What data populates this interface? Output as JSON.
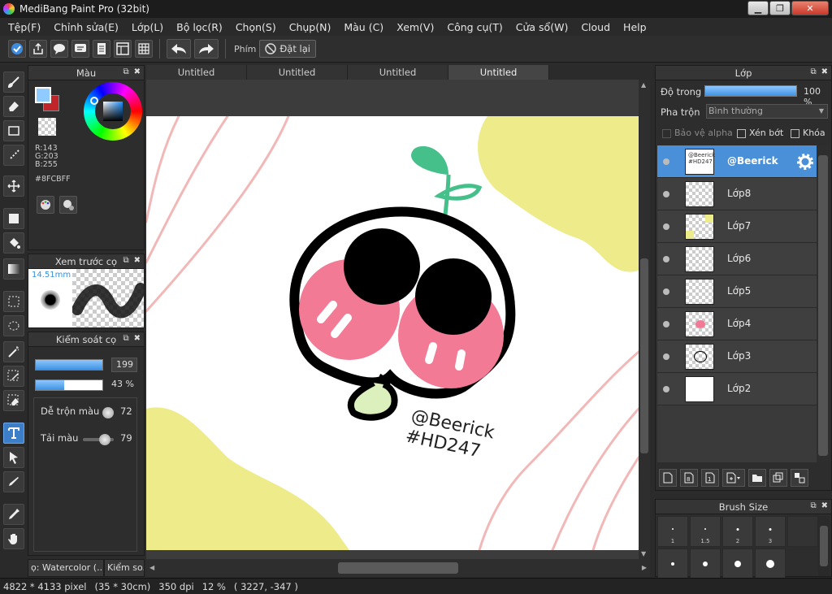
{
  "window": {
    "title": "MediBang Paint Pro (32bit)"
  },
  "menu": [
    "Tệp(F)",
    "Chỉnh sửa(E)",
    "Lớp(L)",
    "Bộ lọc(R)",
    "Chọn(S)",
    "Chụp(N)",
    "Màu (C)",
    "Xem(V)",
    "Công cụ(T)",
    "Cửa sổ(W)",
    "Cloud",
    "Help"
  ],
  "toolbar": {
    "key_label": "Phím",
    "reset_label": "Đặt lại"
  },
  "color_panel": {
    "title": "Màu",
    "fg_color": "#8FCBFF",
    "bg_color": "#C0252A",
    "r": "R:143",
    "g": "G:203",
    "b": "B:255",
    "hex": "#8FCBFF"
  },
  "preview_panel": {
    "title": "Xem trước cọ",
    "size": "14.51mm"
  },
  "control_panel": {
    "title": "Kiểm soát cọ",
    "size_value": "199",
    "opacity_value": "43 %",
    "opacity_fraction": 0.43,
    "blend_label": "Dễ trộn màu",
    "blend_value": "72",
    "load_label": "Tải màu",
    "load_value": "79"
  },
  "bottom_tabs": [
    "ọ: Watercolor (..",
    "Kiểm so.."
  ],
  "doc_tabs": [
    "Untitled",
    "Untitled",
    "Untitled",
    "Untitled"
  ],
  "artwork": {
    "sig1": "@Beerick",
    "sig2": "#HD247"
  },
  "layer_panel": {
    "title": "Lớp",
    "opacity_label": "Độ trong",
    "opacity_value": "100 %",
    "blend_label": "Pha trộn",
    "blend_value": "Bình thường",
    "protect_alpha": "Bảo vệ alpha",
    "clip": "Xén bớt",
    "lock": "Khóa",
    "layers": [
      {
        "name": "@Beerick",
        "thumb_text": "@Beerick #HD247",
        "selected": true
      },
      {
        "name": "Lớp8"
      },
      {
        "name": "Lớp7"
      },
      {
        "name": "Lớp6"
      },
      {
        "name": "Lớp5"
      },
      {
        "name": "Lớp4"
      },
      {
        "name": "Lớp3"
      },
      {
        "name": "Lớp2"
      }
    ]
  },
  "brush_size_panel": {
    "title": "Brush Size",
    "sizes": [
      "1",
      "1.5",
      "2",
      "3"
    ]
  },
  "status": {
    "pixels": "4822 * 4133 pixel",
    "cm": "(35 * 30cm)",
    "dpi": "350 dpi",
    "zoom": "12 %",
    "coords": "( 3227, -347 )"
  },
  "colors": {
    "accent": "#4A90D8",
    "yellow": "#EEEB8A",
    "pink": "#F27A95",
    "green": "#46C08A"
  }
}
